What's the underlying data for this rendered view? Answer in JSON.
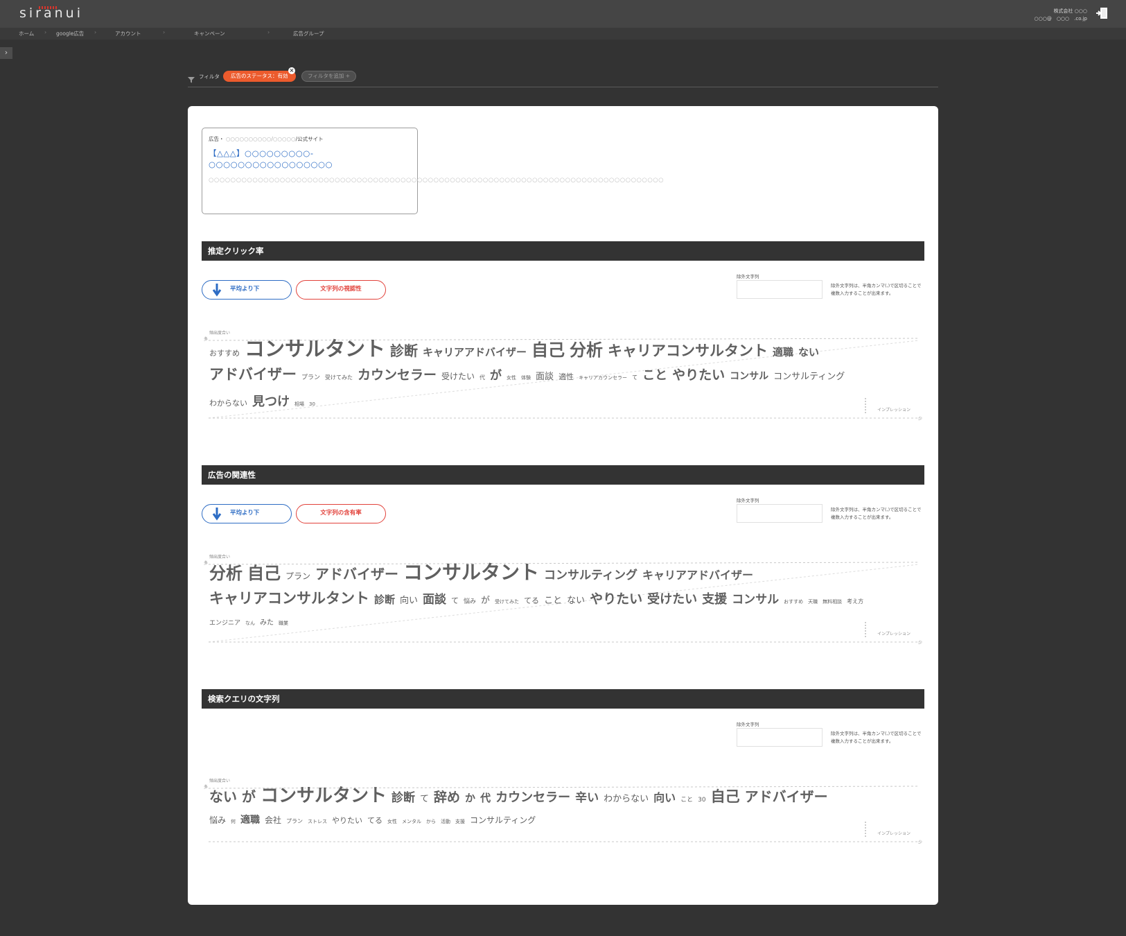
{
  "app": {
    "logo": "siranui",
    "user_company": "株式会社 ○○○",
    "user_email": "○○○@　○○○　.co.jp"
  },
  "breadcrumb": [
    "ホーム",
    "google広告",
    "アカウント",
    "キャンペーン",
    "広告グループ"
  ],
  "filter": {
    "label": "フィルタ",
    "chip": "広告のステータス：有効",
    "add_label": "フィルタを追加 +"
  },
  "ad_preview": {
    "prefix": "広告・",
    "url_part1": "○○○○○○○○○○",
    "url_sep": "/",
    "url_part2": "○○○○○",
    "url_suffix": "/公式サイト",
    "title": "【△△△】○○○○○○○○○-○○○○○○○○○○○○○○○○○",
    "description": "○○○○○○○○○○○○○○○○○○○○○○○○○○○○○○○○○○○○○○○○○○○○○○○○○○○○○○○○○○○○○○○○○○○○○○○○○○○○○○○○○○○"
  },
  "sections": [
    {
      "title": "推定クリック率",
      "btn_blue": "平均より下",
      "btn_red": "文字列の視認性",
      "exclusion_label": "除外文字列",
      "exclusion_value": "",
      "exclusion_note": "除外文字列は、半角カンマ(,)で区切ることで複数入力することが出来ます。",
      "y_axis_label": "頻出度合い",
      "y_axis_marker": "多",
      "x_axis_label": "インプレッション",
      "x_axis_marker": "少",
      "lines": [
        [
          [
            "おすすめ",
            11
          ],
          [
            "コンサルタント",
            29
          ],
          [
            "診断",
            20
          ],
          [
            "キャリアアドバイザー",
            15
          ],
          [
            "自己",
            24
          ],
          [
            "分析",
            24
          ],
          [
            "キャリアコンサルタント",
            21
          ],
          [
            "適職",
            15
          ],
          [
            "ない",
            15
          ]
        ],
        [
          [
            "アドバイザー",
            21
          ],
          [
            "プラン",
            9
          ],
          [
            "受けてみた",
            8
          ],
          [
            "カウンセラー",
            19
          ],
          [
            "受けたい",
            12
          ],
          [
            "代",
            8
          ],
          [
            "が",
            17
          ],
          [
            "女性",
            7
          ],
          [
            "体験",
            7
          ],
          [
            "面談",
            13
          ],
          [
            "適性",
            11
          ],
          [
            "キャリアカウンセラー",
            7
          ],
          [
            "て",
            8
          ],
          [
            "こと",
            18
          ],
          [
            "やりたい",
            19
          ],
          [
            "コンサル",
            14
          ],
          [
            "コンサルティング",
            13
          ]
        ],
        [
          [
            "わからない",
            11
          ],
          [
            "見つけ",
            18
          ],
          [
            "相場",
            7
          ],
          [
            "30",
            7
          ]
        ]
      ]
    },
    {
      "title": "広告の関連性",
      "btn_blue": "平均より下",
      "btn_red": "文字列の含有率",
      "exclusion_label": "除外文字列",
      "exclusion_value": "",
      "exclusion_note": "除外文字列は、半角カンマ(,)で区切ることで複数入力することが出来ます。",
      "y_axis_label": "頻出度合い",
      "y_axis_marker": "多",
      "x_axis_label": "インプレッション",
      "x_axis_marker": "少",
      "lines": [
        [
          [
            "分析",
            24
          ],
          [
            "自己",
            24
          ],
          [
            "プラン",
            12
          ],
          [
            "アドバイザー",
            20
          ],
          [
            "コンサルタント",
            28
          ],
          [
            "コンサルティング",
            17
          ],
          [
            "キャリアアドバイザー",
            16
          ]
        ],
        [
          [
            "キャリアコンサルタント",
            21
          ],
          [
            "診断",
            15
          ],
          [
            "向い",
            13
          ],
          [
            "面談",
            17
          ],
          [
            "て",
            11
          ],
          [
            "悩み",
            9
          ],
          [
            "が",
            13
          ],
          [
            "受けてみた",
            7
          ],
          [
            "てる",
            11
          ],
          [
            "こと",
            13
          ],
          [
            "ない",
            13
          ],
          [
            "やりたい",
            19
          ],
          [
            "受けたい",
            18
          ],
          [
            "支援",
            18
          ],
          [
            "コンサル",
            17
          ],
          [
            "おすすめ",
            7
          ],
          [
            "天職",
            7
          ],
          [
            "無料相談",
            7
          ],
          [
            "考え方",
            8
          ]
        ],
        [
          [
            "エンジニア",
            9
          ],
          [
            "なん",
            7
          ],
          [
            "みた",
            10
          ],
          [
            "職業",
            7
          ]
        ]
      ]
    },
    {
      "title": "検索クエリの文字列",
      "exclusion_label": "除外文字列",
      "exclusion_value": "",
      "exclusion_note": "除外文字列は、半角カンマ(,)で区切ることで複数入力することが出来ます。",
      "y_axis_label": "頻出度合い",
      "y_axis_marker": "多",
      "x_axis_label": "インプレッション",
      "x_axis_marker": "少",
      "lines": [
        [
          [
            "ない",
            20
          ],
          [
            "が",
            20
          ],
          [
            "コンサルタント",
            26
          ],
          [
            "診断",
            17
          ],
          [
            "て",
            13
          ],
          [
            "辞め",
            19
          ],
          [
            "か",
            15
          ],
          [
            "代",
            15
          ],
          [
            "カウンセラー",
            18
          ],
          [
            "辛い",
            17
          ],
          [
            "わからない",
            13
          ],
          [
            "向い",
            16
          ],
          [
            "こと",
            9
          ],
          [
            "30",
            9
          ],
          [
            "自己",
            21
          ],
          [
            "アドバイザー",
            20
          ]
        ],
        [
          [
            "悩み",
            12
          ],
          [
            "何",
            7
          ],
          [
            "適職",
            14
          ],
          [
            "会社",
            12
          ],
          [
            "プラン",
            8
          ],
          [
            "ストレス",
            7
          ],
          [
            "やりたい",
            11
          ],
          [
            "てる",
            11
          ],
          [
            "女性",
            7
          ],
          [
            "メンタル",
            7
          ],
          [
            "から",
            7
          ],
          [
            "活動",
            7
          ],
          [
            "支援",
            7
          ],
          [
            "コンサルティング",
            12
          ]
        ]
      ]
    }
  ],
  "colors": {
    "accent_orange": "#ec5b2d",
    "blue": "#2d6cc4",
    "red": "#e2413a",
    "header_dark": "#333333"
  }
}
